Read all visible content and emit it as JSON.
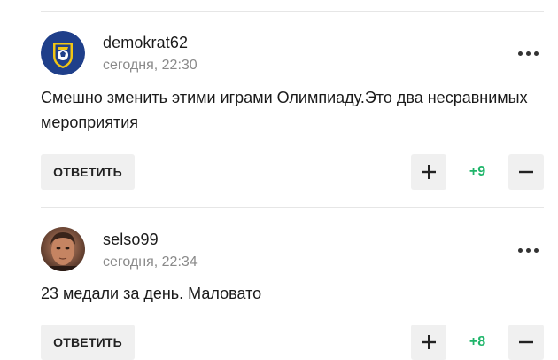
{
  "comments": [
    {
      "username": "demokrat62",
      "time": "сегодня, 22:30",
      "text": "Смешно зменить этими играми Олимпиаду.Это два несравнимых мероприятия",
      "reply_label": "ОТВЕТИТЬ",
      "score": "+9",
      "avatar_icon": "football-club-crest-icon"
    },
    {
      "username": "selso99",
      "time": "сегодня, 22:34",
      "text": "23 медали за день. Маловато",
      "reply_label": "ОТВЕТИТЬ",
      "score": "+8",
      "avatar_icon": "user-photo-avatar"
    }
  ],
  "colors": {
    "score_positive": "#1fb56a",
    "button_bg": "#f0f0f0",
    "muted_text": "#8a8a8a"
  }
}
